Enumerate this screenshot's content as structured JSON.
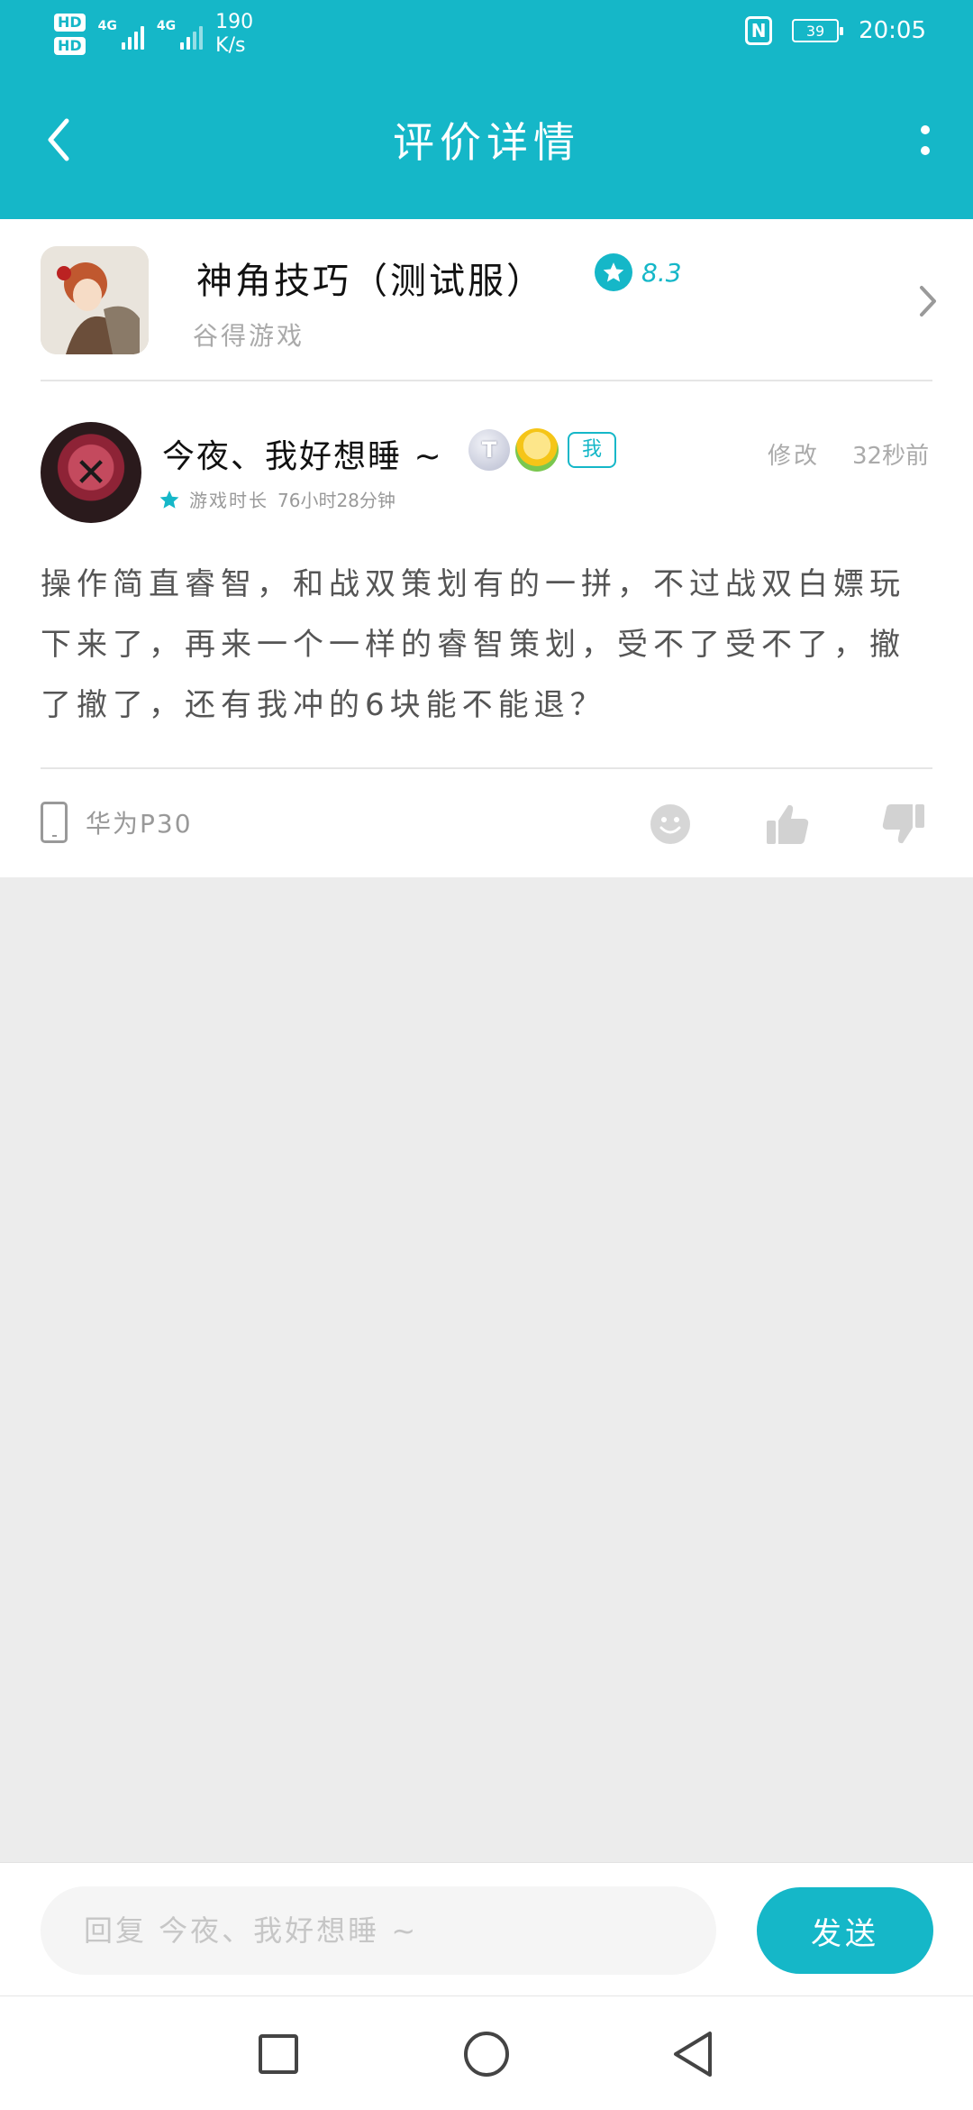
{
  "status_bar": {
    "hd1": "HD",
    "hd2": "HD",
    "net1": "4G",
    "net2": "4G",
    "speed_value": "190",
    "speed_unit": "K/s",
    "nfc": "N",
    "battery": "39",
    "time": "20:05"
  },
  "header": {
    "title": "评价详情",
    "back_icon": "chevron-left-icon",
    "more_icon": "more-vertical-icon"
  },
  "game": {
    "name": "神角技巧（测试服）",
    "rating": "8.3",
    "developer": "谷得游戏"
  },
  "review": {
    "username": "今夜、我好想睡 ~",
    "me_badge": "我",
    "edit_label": "修改",
    "time_ago": "32秒前",
    "playtime_label": "游戏时长",
    "playtime_value": "76小时28分钟",
    "content": "操作简直睿智，和战双策划有的一拼，不过战双白嫖玩下来了，再来一个一样的睿智策划，受不了受不了，撤了撤了，还有我冲的6块能不能退？",
    "device": "华为P30"
  },
  "reply": {
    "placeholder": "回复 今夜、我好想睡 ~",
    "value": "",
    "send_label": "发送"
  },
  "colors": {
    "accent": "#15b7c8",
    "background": "#ececec"
  }
}
